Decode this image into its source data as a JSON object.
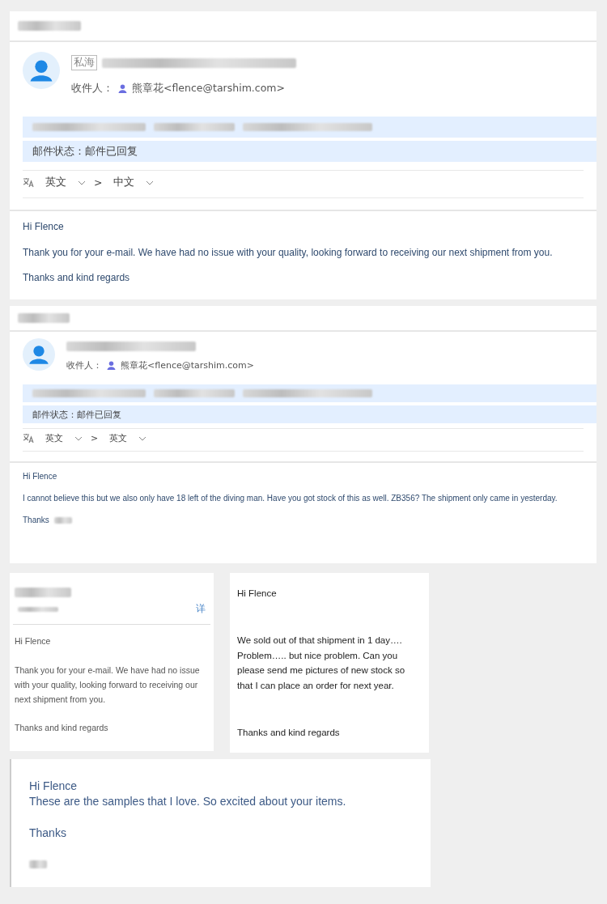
{
  "cards": [
    {
      "kind": "full",
      "sender_tag": "私海",
      "recipient_label": "收件人：",
      "recipient": "熊章花<flence@tarshim.com>",
      "status": "邮件状态：邮件已回复",
      "translate_from": "英文",
      "translate_arrow": ">",
      "translate_to": "中文",
      "body": [
        "Hi Flence",
        "Thank you for your e-mail.  We have had no issue with your quality, looking forward to receiving our next shipment from you.",
        "Thanks and kind regards"
      ]
    },
    {
      "kind": "full-small",
      "recipient_label": "收件人：",
      "recipient": "熊章花<flence@tarshim.com>",
      "status": "邮件状态：邮件已回复",
      "translate_from": "英文",
      "translate_arrow": ">",
      "translate_to": "英文",
      "body": [
        "Hi Flence",
        "I cannot believe this but we also only have 18 left of the diving man.  Have you got stock of this as well.  ZB356? The shipment only came in yesterday.",
        "Thanks"
      ]
    },
    {
      "kind": "compact",
      "details_link": "详",
      "body": [
        "Hi Flence",
        "Thank you for your e-mail.  We have had no issue with your quality, looking forward to receiving our next shipment from you.",
        "Thanks and kind regards"
      ]
    },
    {
      "kind": "plain",
      "body": [
        "Hi Flence",
        "We sold out of that shipment in 1 day…. Problem….. but nice problem.   Can you please send me pictures of new stock so that I can place an order for next year.",
        "Thanks and kind regards"
      ]
    },
    {
      "kind": "large",
      "body": [
        "Hi Flence",
        "These are the samples that I love.   So excited about your items.",
        "Thanks"
      ]
    }
  ]
}
